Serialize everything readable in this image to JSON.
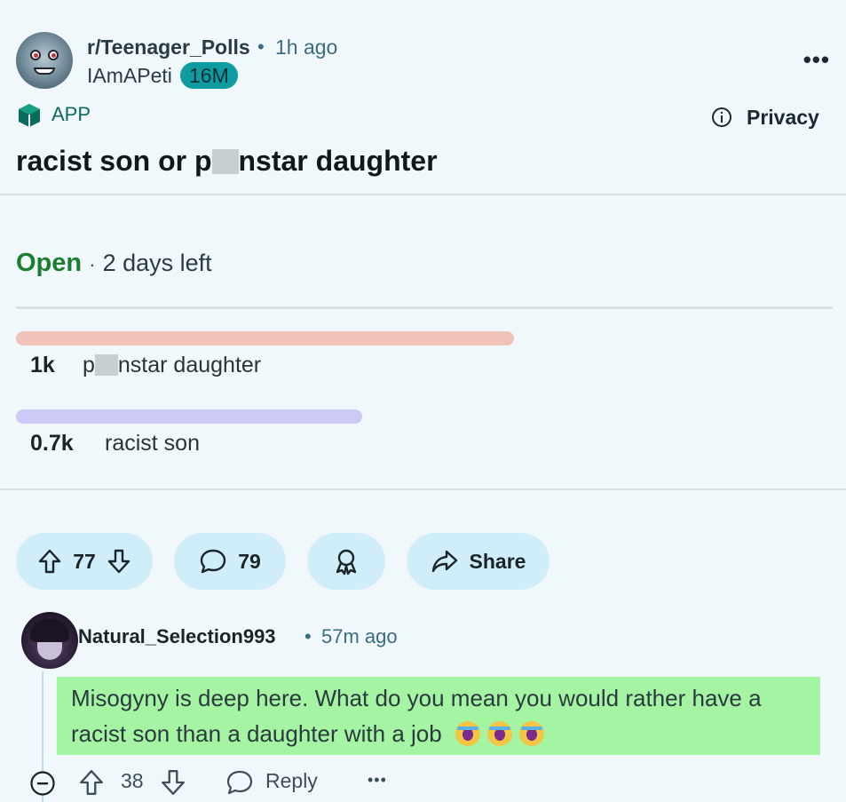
{
  "post": {
    "subreddit": "r/Teenager_Polls",
    "separator": "•",
    "time_ago": "1h ago",
    "author": "IAmAPeti",
    "badge": "16M",
    "more": "•••",
    "app_label": "APP",
    "privacy_label": "Privacy",
    "title_part1": "racist son or p",
    "title_part2": "nstar daughter"
  },
  "poll": {
    "status": "Open",
    "separator": "·",
    "time_left": "2 days left",
    "options": [
      {
        "count": "1k",
        "label_part1": "p",
        "label_part2": "nstar daughter",
        "fraction": 0.59,
        "color": "#f0c2b8"
      },
      {
        "count": "0.7k",
        "label": "racist son",
        "fraction": 0.41,
        "color": "#cccaf6"
      }
    ]
  },
  "actions": {
    "upvotes": "77",
    "comments": "79",
    "share_label": "Share"
  },
  "comment": {
    "author": "Natural_Selection993",
    "separator": "•",
    "time_ago": "57m ago",
    "body": "Misogyny is deep here. What do you mean you would rather have a racist son than a daughter with a job",
    "votes": "38",
    "reply_label": "Reply",
    "more": "•••",
    "highlight_color": "#a4f4a4"
  },
  "icons": [
    "subreddit-avatar",
    "more-icon",
    "app-icon",
    "info-icon",
    "upvote-icon",
    "downvote-icon",
    "comment-icon",
    "award-icon",
    "share-icon",
    "collapse-icon",
    "reply-icon",
    "crying-emoji-icon"
  ]
}
